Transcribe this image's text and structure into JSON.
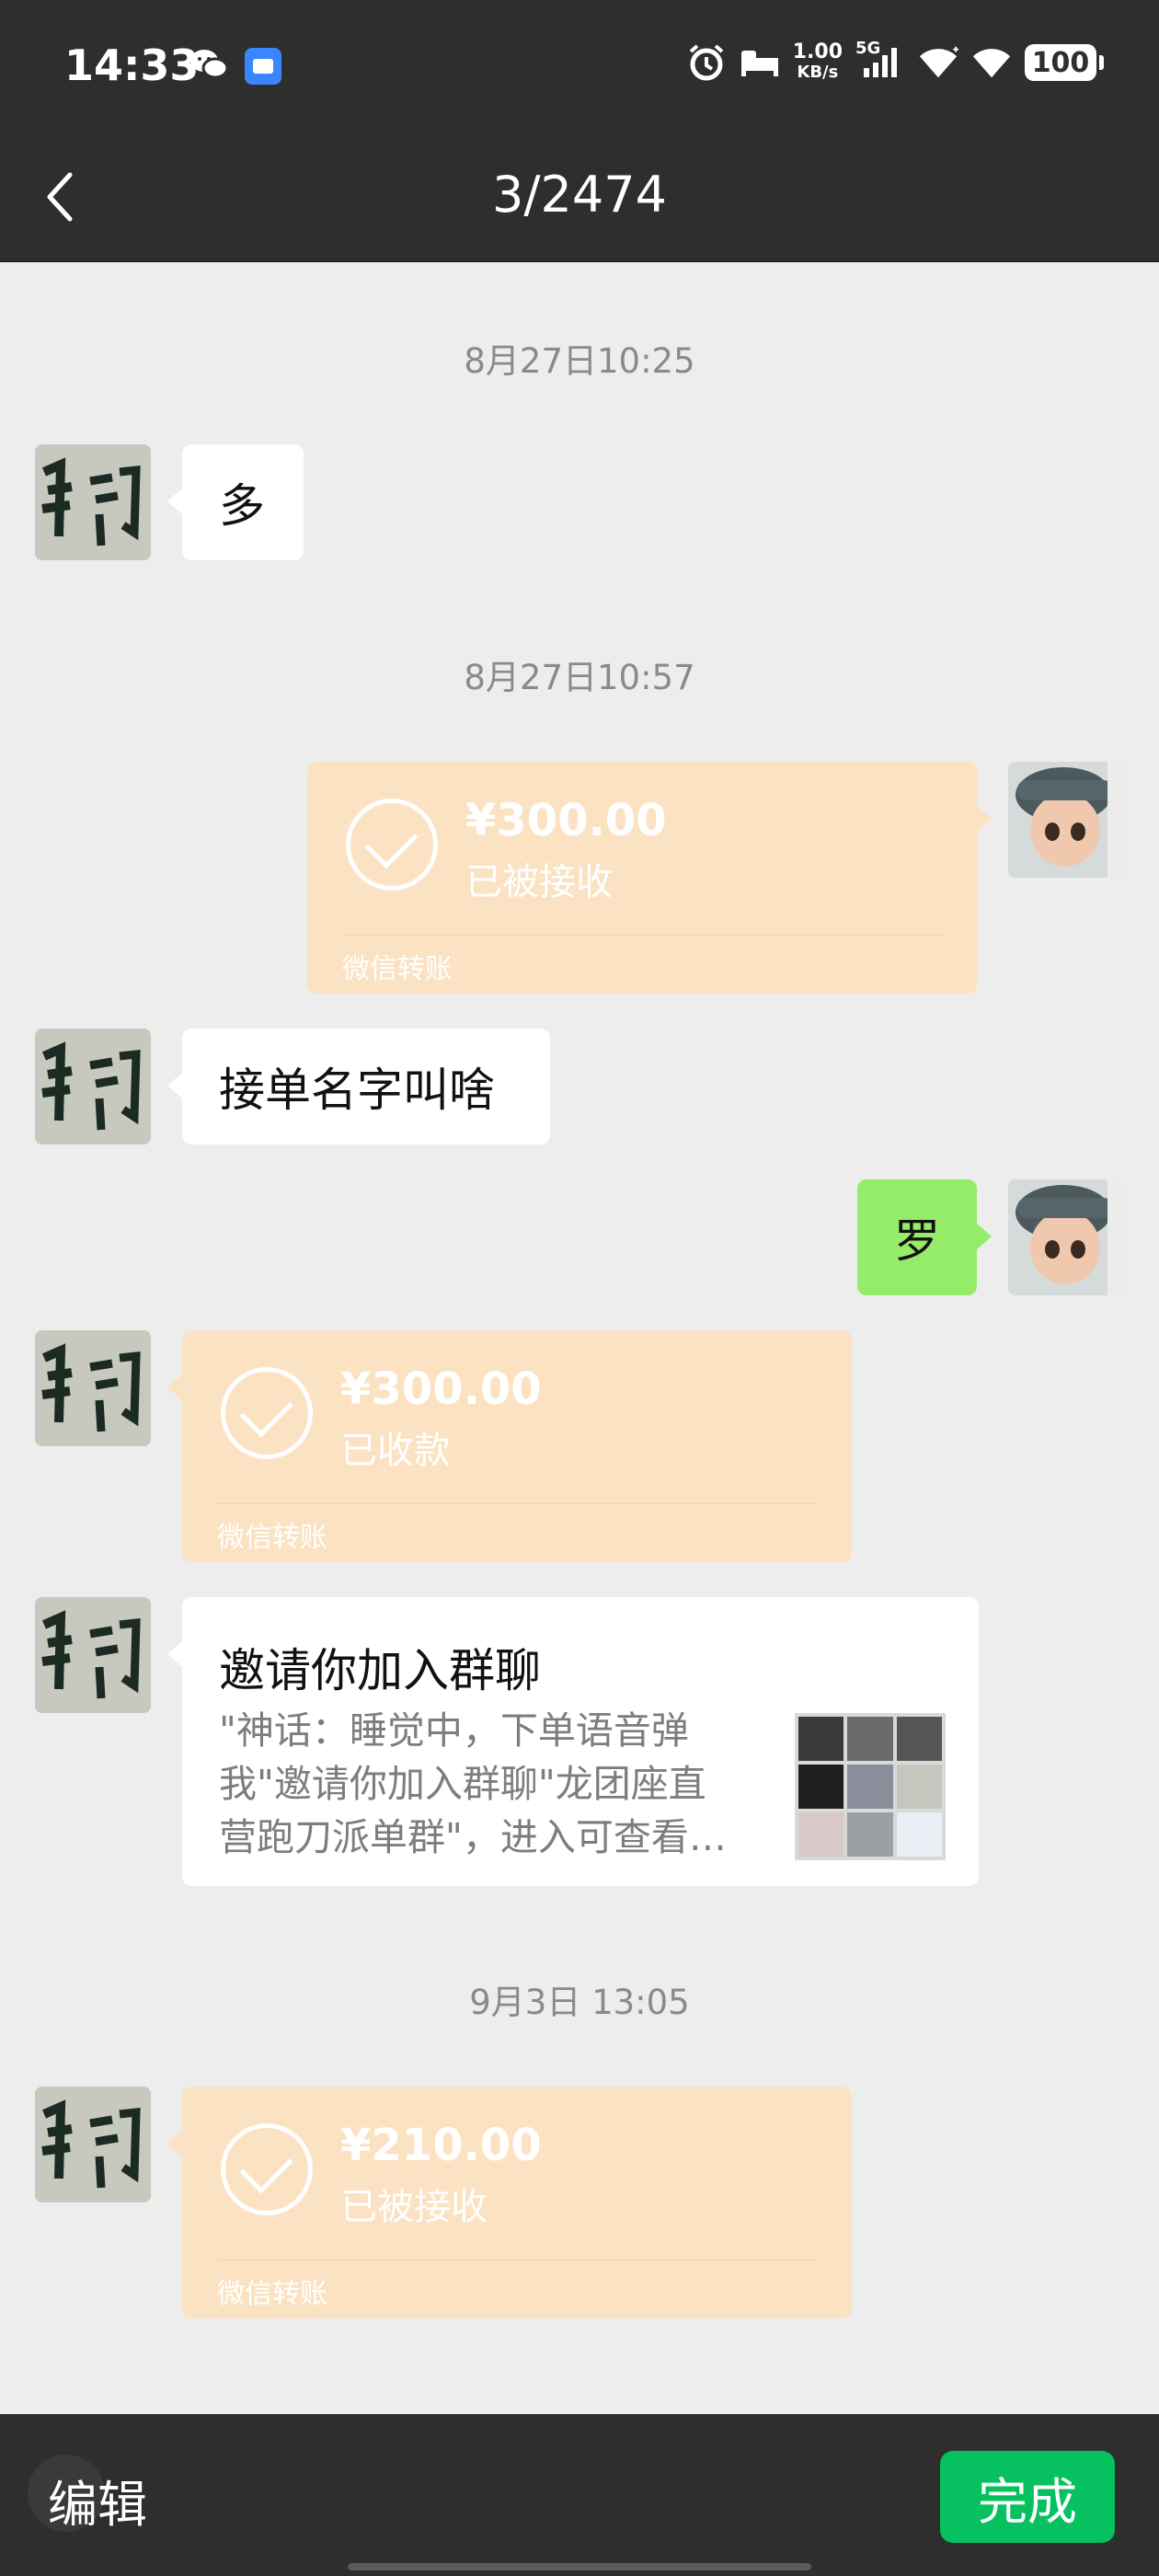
{
  "status_bar": {
    "time": "14:33",
    "speed_value": "1.00",
    "speed_unit": "KB/s",
    "network": "5G",
    "battery": "100",
    "icons": [
      "wechat-icon",
      "app-icon",
      "alarm-icon",
      "bed-icon",
      "signal-icon",
      "wifi-icon",
      "wifi-icon",
      "battery-icon"
    ]
  },
  "header": {
    "title": "3/2474"
  },
  "messages": {
    "ts1": "8月27日10:25",
    "m1_text": "多",
    "ts2": "8月27日10:57",
    "t1": {
      "amount": "¥300.00",
      "status": "已被接收",
      "footer": "微信转账"
    },
    "m2_text": "接单名字叫啥",
    "m3_text": "罗",
    "t2": {
      "amount": "¥300.00",
      "status": "已收款",
      "footer": "微信转账"
    },
    "invite": {
      "title": "邀请你加入群聊",
      "desc": "\"神话：睡觉中，下单语音弹\n我\"邀请你加入群聊\"龙团座直\n营跑刀派单群\"，进入可查看…"
    },
    "ts3": "9月3日 13:05",
    "t3": {
      "amount": "¥210.00",
      "status": "已被接收",
      "footer": "微信转账"
    }
  },
  "bottom": {
    "edit_label": "编辑",
    "done_label": "完成"
  },
  "colors": {
    "header_bg": "#2e2e2e",
    "chat_bg": "#ededed",
    "transfer_bg": "#fbe2c2",
    "green_bubble": "#95ec69",
    "done_button": "#07c160"
  }
}
